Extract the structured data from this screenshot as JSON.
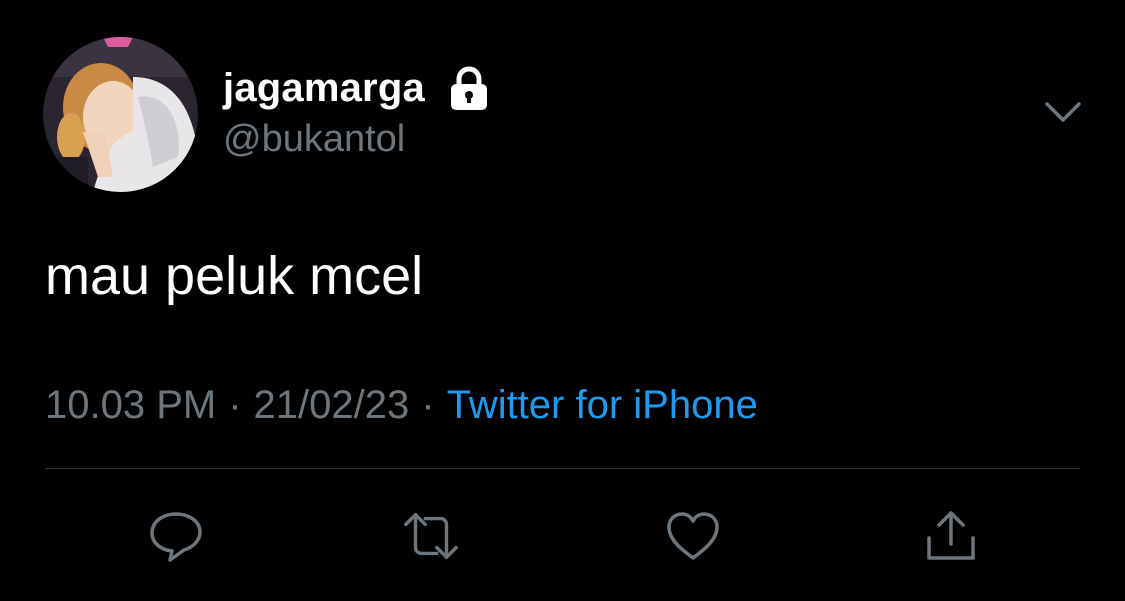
{
  "tweet": {
    "author": {
      "display_name": "jagamarga",
      "handle": "@bukantol",
      "protected": true,
      "avatar": "profile-photo"
    },
    "text": "mau peluk mcel",
    "meta": {
      "time": "10.03 PM",
      "separator": "·",
      "date": "21/02/23",
      "source": "Twitter for iPhone"
    },
    "actions": [
      {
        "name": "reply",
        "icon": "reply-icon"
      },
      {
        "name": "retweet",
        "icon": "retweet-icon"
      },
      {
        "name": "like",
        "icon": "heart-icon"
      },
      {
        "name": "share",
        "icon": "share-icon"
      }
    ]
  },
  "colors": {
    "background": "#000000",
    "primary_text": "#ffffff",
    "secondary_text": "#6e767d",
    "link": "#1d9bf0",
    "divider": "#2f3336"
  }
}
